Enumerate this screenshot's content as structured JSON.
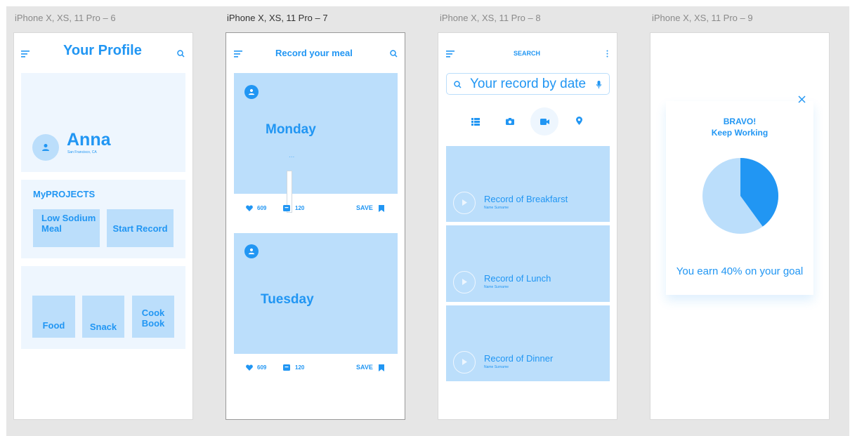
{
  "artboards": [
    {
      "label": "iPhone X, XS, 11 Pro – 6"
    },
    {
      "label": "iPhone X, XS, 11 Pro – 7"
    },
    {
      "label": "iPhone X, XS, 11 Pro – 8"
    },
    {
      "label": "iPhone X, XS, 11 Pro – 9"
    }
  ],
  "profile": {
    "title": "Your Profile",
    "name": "Anna",
    "location": "San Francisco, CA",
    "projects_heading": "MyPROJECTS",
    "project_buttons": [
      "Low Sodium Meal",
      "Start Record"
    ],
    "category_buttons": [
      "Food",
      "Snack",
      "Cook Book"
    ]
  },
  "record": {
    "title": "Record your meal",
    "cards": [
      {
        "day": "Monday",
        "likes": "609",
        "comments": "120",
        "save": "SAVE"
      },
      {
        "day": "Tuesday",
        "likes": "609",
        "comments": "120",
        "save": "SAVE"
      }
    ],
    "ellipsis": "..."
  },
  "search": {
    "title": "SEARCH",
    "placeholder": "Your record by date",
    "records": [
      {
        "title": "Record of Breakfarst",
        "subtitle": "Name Surname"
      },
      {
        "title": "Record of Lunch",
        "subtitle": "Name Surname"
      },
      {
        "title": "Record of Dinner",
        "subtitle": "Name Surname"
      }
    ]
  },
  "bravo": {
    "heading": "BRAVO!",
    "subheading": "Keep Working",
    "message": "You earn 40% on your goal",
    "progress_percent": 40
  },
  "colors": {
    "accent": "#2196f3",
    "light": "#bbdefb",
    "pale": "#eef6fe",
    "canvas": "#e6e6e6"
  }
}
